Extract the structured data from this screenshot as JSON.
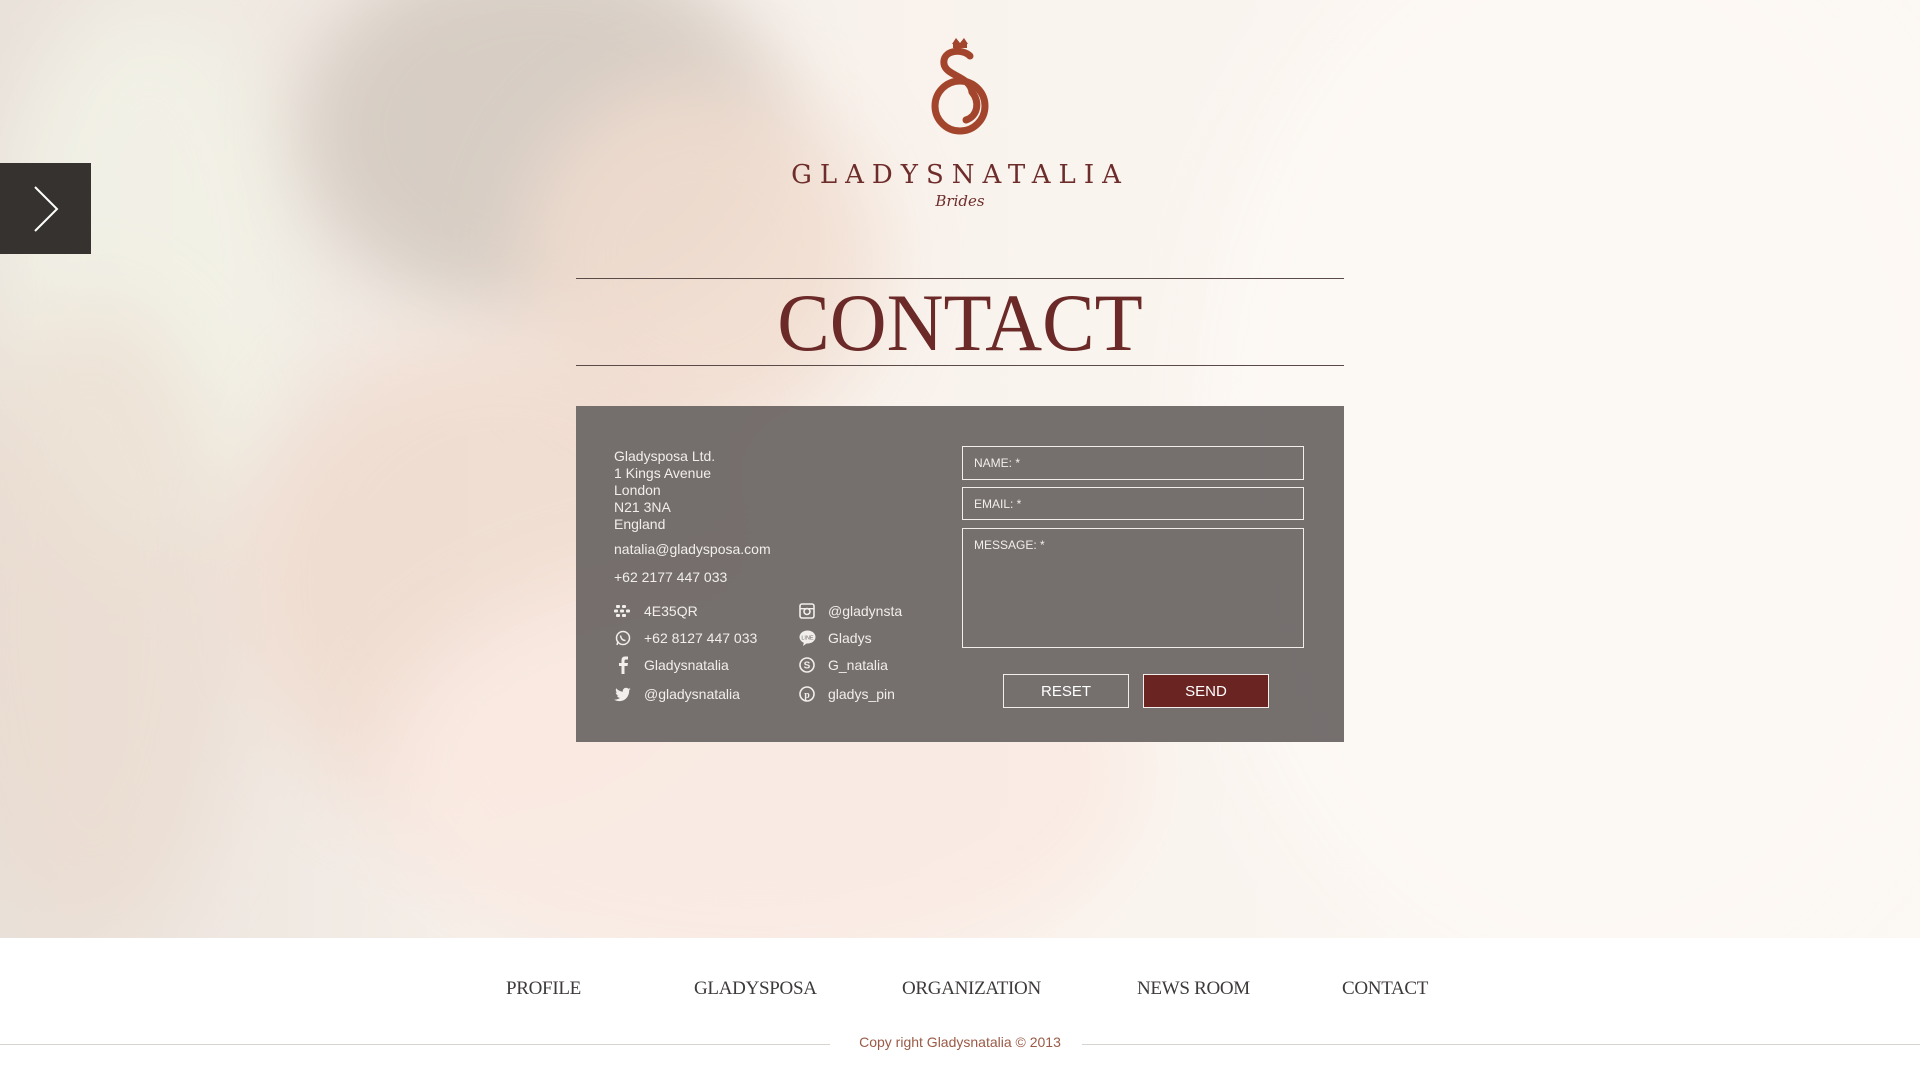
{
  "brand": {
    "name": "GLADYSNATALIA",
    "tagline": "Brides",
    "color": "#6d2d2b"
  },
  "page_title": "CONTACT",
  "side_nav": {
    "icon": "chevron-right-icon"
  },
  "address": {
    "company": "Gladysposa Ltd.",
    "street": "1 Kings Avenue",
    "city": "London",
    "postcode": "N21 3NA",
    "country": "England"
  },
  "email": "natalia@gladysposa.com",
  "phone": "+62 2177 447 033",
  "social_left": [
    {
      "icon": "blackberry-icon",
      "value": "4E35QR"
    },
    {
      "icon": "whatsapp-icon",
      "value": "+62 8127 447 033"
    },
    {
      "icon": "facebook-icon",
      "value": "Gladysnatalia"
    },
    {
      "icon": "twitter-icon",
      "value": "@gladysnatalia"
    }
  ],
  "social_right": [
    {
      "icon": "instagram-icon",
      "value": "@gladynsta"
    },
    {
      "icon": "line-icon",
      "value": "Gladys"
    },
    {
      "icon": "skype-icon",
      "value": "G_natalia"
    },
    {
      "icon": "pinterest-icon",
      "value": "gladys_pin"
    }
  ],
  "form": {
    "name_placeholder": "NAME: *",
    "email_placeholder": "EMAIL: *",
    "message_placeholder": "MESSAGE: *",
    "reset_label": "RESET",
    "send_label": "SEND",
    "send_color": "#6a2422"
  },
  "footer_nav": [
    "PROFILE",
    "GLADYSPOSA",
    "ORGANIZATION",
    "NEWS ROOM",
    "CONTACT"
  ],
  "copyright": "Copy right Gladysnatalia © 2013"
}
